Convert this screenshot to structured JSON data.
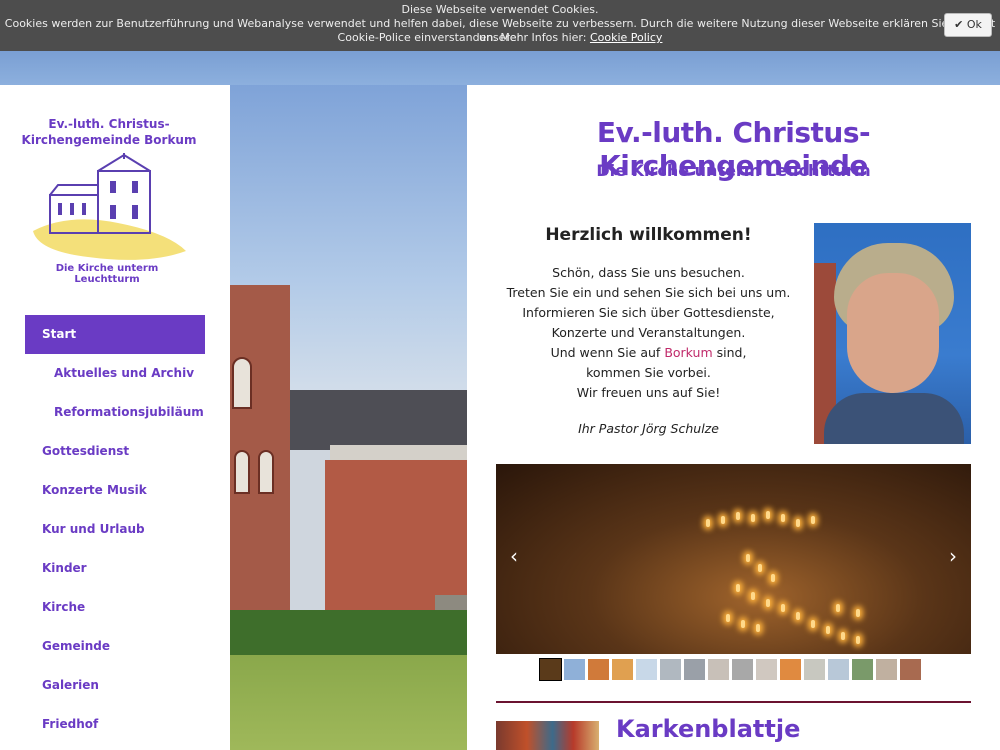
{
  "cookie_banner": {
    "title": "Diese Webseite verwendet Cookies.",
    "text": "Cookies werden zur Benutzerführung und Webanalyse verwendet und helfen dabei, diese Webseite zu verbessern. Durch die weitere Nutzung dieser Webseite erklären Sie sich mit unserer",
    "text2": "Cookie-Police einverstanden. Mehr Infos hier:",
    "link": "Cookie Policy",
    "ok_label": "Ok",
    "ok_icon": "checkmark-icon"
  },
  "sidebar": {
    "logo_title_line1": "Ev.-luth. Christus-",
    "logo_title_line2": "Kirchengemeinde Borkum",
    "logo_subtitle": "Die Kirche unterm Leuchtturm",
    "nav": [
      {
        "label": "Start",
        "active": true
      },
      {
        "label": "Aktuelles und Archiv",
        "sub": true
      },
      {
        "label": "Reformationsjubiläum",
        "sub": true
      },
      {
        "label": "Gottesdienst"
      },
      {
        "label": "Konzerte Musik"
      },
      {
        "label": "Kur und Urlaub"
      },
      {
        "label": "Kinder"
      },
      {
        "label": "Kirche"
      },
      {
        "label": "Gemeinde"
      },
      {
        "label": "Galerien"
      },
      {
        "label": "Friedhof"
      }
    ]
  },
  "main": {
    "title": "Ev.-luth. Christus-Kirchengemeinde",
    "subtitle": "Die Kirche unterm Leuchtturm",
    "welcome_heading": "Herzlich willkommen!",
    "lines": [
      "Schön, dass Sie uns besuchen.",
      "Treten Sie ein und sehen Sie sich bei uns um.",
      "Informieren Sie sich über Gottesdienste,",
      "Konzerte und Veranstaltungen."
    ],
    "line5_before": "Und wenn Sie auf ",
    "line5_highlight": "Borkum",
    "line5_after": " sind,",
    "line6": "kommen Sie vorbei.",
    "line7": "Wir freuen uns auf Sie!",
    "signature": "Ihr Pastor Jörg Schulze",
    "section_title": "Karkenblattje"
  },
  "slider": {
    "prev_icon": "chevron-left-icon",
    "next_icon": "chevron-right-icon",
    "prev_glyph": "‹",
    "next_glyph": "›",
    "thumb_colors": [
      "#5a3a1a",
      "#8fb0d8",
      "#d07a3a",
      "#e0a050",
      "#c8d8e8",
      "#b0b8c0",
      "#9aa0a8",
      "#c8c0b8",
      "#a8a8a8",
      "#d0c8c0",
      "#e08a40",
      "#c8c8c0",
      "#b8c8d8",
      "#7a9a6a",
      "#c0b0a0",
      "#a86a50"
    ]
  },
  "colors": {
    "accent": "#6a3bc4",
    "highlight": "#c02a6a",
    "divider": "#6b1330"
  }
}
